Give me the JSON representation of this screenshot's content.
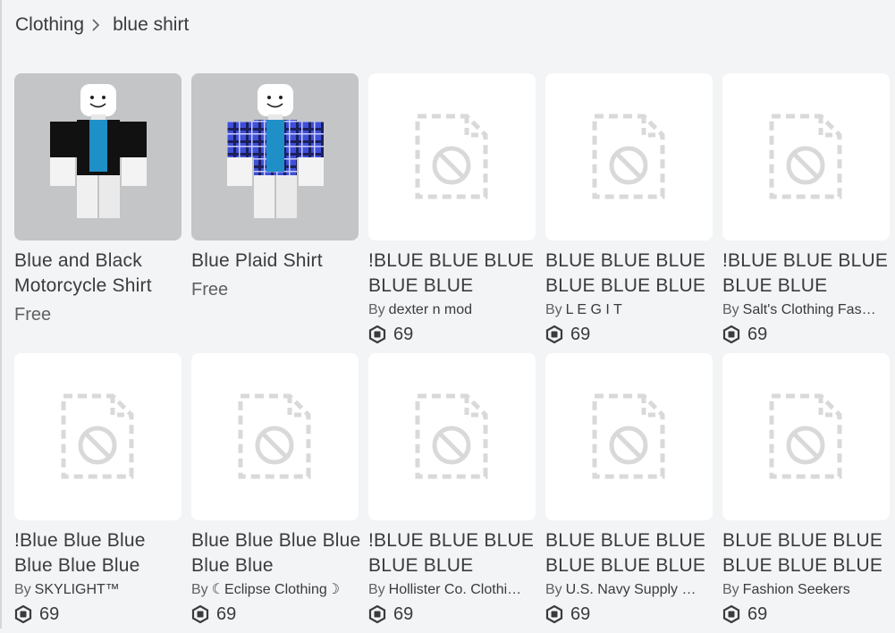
{
  "breadcrumb": {
    "parent": "Clothing",
    "current": "blue shirt"
  },
  "colors": {
    "background": "#f2f4f5",
    "text": "#393b3d",
    "muted": "#606162",
    "placeholder": "#d9d9d9"
  },
  "icons": {
    "robux": "robux-icon",
    "placeholder": "unavailable-image-icon",
    "separator": "chevron-right-icon"
  },
  "items": [
    {
      "name": "Blue and Black Motorcycle Shirt",
      "creator_prefix": "",
      "creator": "",
      "price": "Free",
      "thumb": "avatar-black"
    },
    {
      "name": "Blue Plaid Shirt",
      "creator_prefix": "",
      "creator": "",
      "price": "Free",
      "thumb": "avatar-plaid"
    },
    {
      "name": "!BLUE BLUE BLUE BLUE BLUE",
      "creator_prefix": "By",
      "creator": "dexter n mod",
      "price": "69",
      "thumb": "placeholder"
    },
    {
      "name": "BLUE BLUE BLUE BLUE BLUE BLUE",
      "creator_prefix": "By",
      "creator": "L E G I T",
      "price": "69",
      "thumb": "placeholder"
    },
    {
      "name": "!BLUE BLUE BLUE BLUE BLUE",
      "creator_prefix": "By",
      "creator": "Salt's Clothing Fas…",
      "price": "69",
      "thumb": "placeholder"
    },
    {
      "name": "!Blue Blue Blue Blue Blue Blue",
      "creator_prefix": "By",
      "creator": "SKYLIGHT™",
      "price": "69",
      "thumb": "placeholder"
    },
    {
      "name": "Blue Blue Blue Blue Blue Blue",
      "creator_prefix": "By",
      "creator": "☾Eclipse Clothing☽",
      "price": "69",
      "thumb": "placeholder"
    },
    {
      "name": "!BLUE BLUE BLUE BLUE BLUE",
      "creator_prefix": "By",
      "creator": "Hollister Co. Clothi…",
      "price": "69",
      "thumb": "placeholder"
    },
    {
      "name": "BLUE BLUE BLUE BLUE BLUE BLUE",
      "creator_prefix": "By",
      "creator": "U.S. Navy Supply …",
      "price": "69",
      "thumb": "placeholder"
    },
    {
      "name": "BLUE BLUE BLUE BLUE BLUE BLUE",
      "creator_prefix": "By",
      "creator": "Fashion Seekers",
      "price": "69",
      "thumb": "placeholder"
    }
  ]
}
